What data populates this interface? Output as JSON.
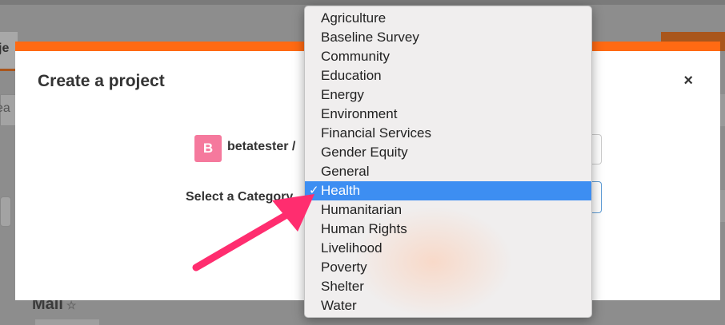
{
  "background": {
    "tab_fragment": "je",
    "search_fragment": "ea",
    "section_heading": "Mali",
    "star_icon": "star-icon"
  },
  "modal": {
    "title": "Create a project",
    "close_symbol": "×",
    "owner": {
      "avatar_letter": "B",
      "name": "betatester /"
    },
    "category_label": "Select a Category",
    "select_arrow": "⇕"
  },
  "dropdown": {
    "selected": "Health",
    "check_symbol": "✓",
    "options": [
      "Agriculture",
      "Baseline Survey",
      "Community",
      "Education",
      "Energy",
      "Environment",
      "Financial Services",
      "Gender Equity",
      "General",
      "Health",
      "Humanitarian",
      "Human Rights",
      "Livelihood",
      "Poverty",
      "Shelter",
      "Water"
    ]
  },
  "colors": {
    "accent": "#ff6a13",
    "avatar": "#f5799d",
    "selection": "#3d8ef2",
    "annotation_arrow": "#ff2d6f"
  }
}
